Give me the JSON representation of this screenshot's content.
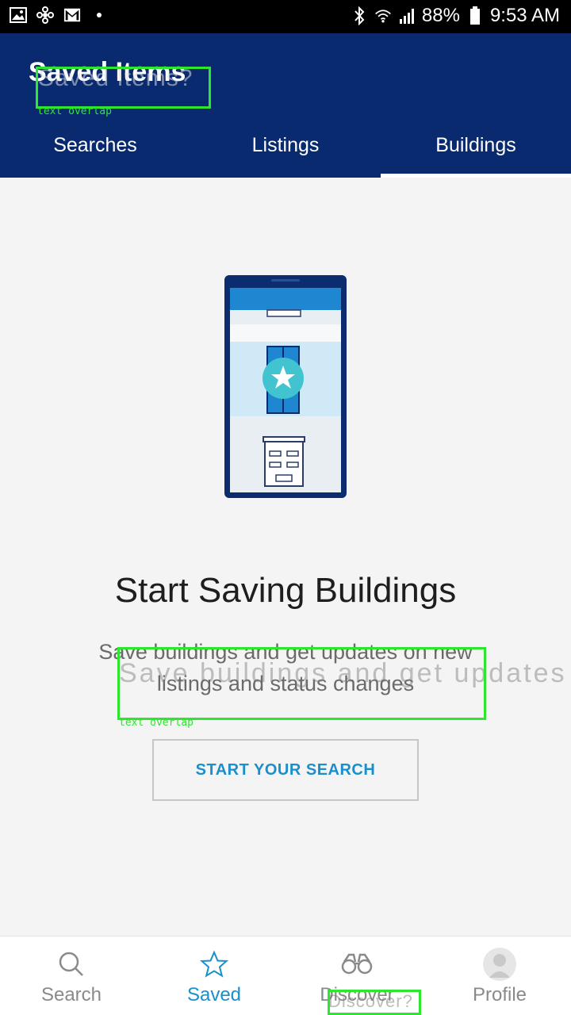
{
  "status_bar": {
    "battery": "88%",
    "time": "9:53 AM"
  },
  "header": {
    "title": "Saved Items",
    "overlay_text": "Saved Items?",
    "overlay_tag": "text overlap"
  },
  "tabs": [
    {
      "label": "Searches"
    },
    {
      "label": "Listings"
    },
    {
      "label": "Buildings"
    }
  ],
  "empty_state": {
    "headline": "Start Saving Buildings",
    "subtitle": "Save buildings and get updates on new listings and status changes",
    "overlay_text": "Save buildings and get updates",
    "overlay_tag": "text overlap",
    "cta_label": "START YOUR SEARCH"
  },
  "bottom_nav": {
    "items": [
      {
        "label": "Search",
        "icon": "search-icon"
      },
      {
        "label": "Saved",
        "icon": "star-icon"
      },
      {
        "label": "Discover",
        "icon": "binoculars-icon"
      },
      {
        "label": "Profile",
        "icon": "avatar-icon"
      }
    ],
    "overlay_text": "Discover?"
  },
  "colors": {
    "header_bg": "#092a6e",
    "accent": "#1a8fcc",
    "overlay": "#2ee62e"
  }
}
